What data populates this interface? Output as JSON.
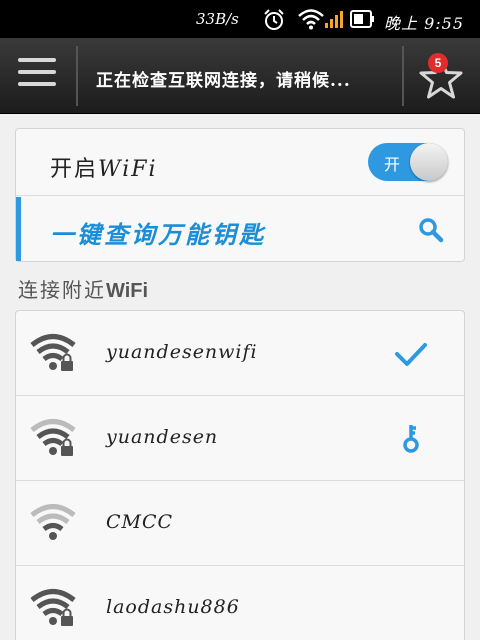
{
  "status_bar": {
    "speed": "33B/s",
    "time": "晚上 9:55",
    "icons": [
      "alarm-icon",
      "wifi-signal-icon",
      "cell-signal-icon",
      "battery-icon"
    ]
  },
  "header": {
    "title": "正在检查互联网连接，请稍候...",
    "badge_count": "5",
    "icons": [
      "menu-icon",
      "star-icon"
    ]
  },
  "wifi_toggle": {
    "label_prefix": "开启",
    "label_suffix": "WiFi",
    "switch_label": "开",
    "state": "on"
  },
  "query": {
    "label": "一键查询万能钥匙",
    "icon": "search-icon"
  },
  "section": {
    "title_prefix": "连接附近",
    "title_suffix": "WiFi"
  },
  "networks": [
    {
      "name": "yuandesenwifi",
      "locked": true,
      "status": "connected",
      "status_icon": "checkmark-icon"
    },
    {
      "name": "yuandesen",
      "locked": true,
      "status": "key-available",
      "status_icon": "key-icon"
    },
    {
      "name": "CMCC",
      "locked": false,
      "status": "",
      "status_icon": ""
    },
    {
      "name": "laodashu886",
      "locked": true,
      "status": "",
      "status_icon": ""
    }
  ],
  "colors": {
    "accent": "#2e99e0",
    "header_bg": "#2a2a2a",
    "badge": "#e02c2c",
    "wifi_icon": "#555555"
  }
}
